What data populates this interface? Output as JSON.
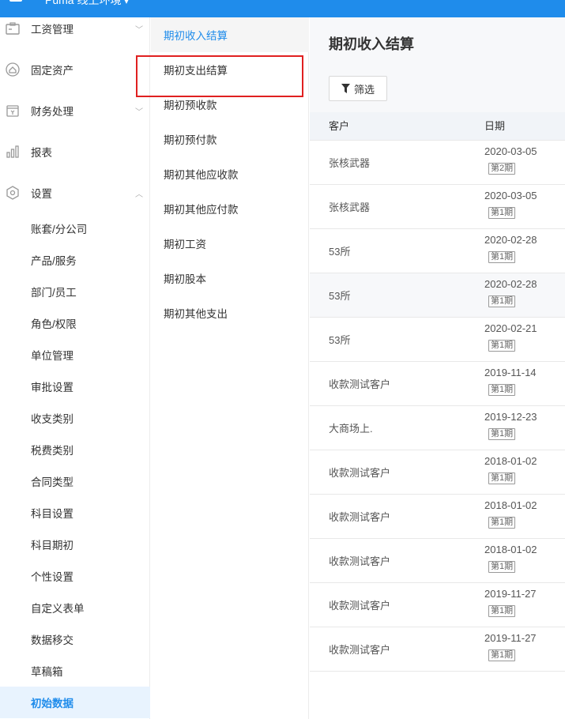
{
  "header": {
    "env_label": "Puma 线上环境",
    "chevron": "chevron-down-icon"
  },
  "sidebar": {
    "groups": [
      {
        "label": "工资管理",
        "icon": "payroll-icon",
        "chevron": "chevron-down-icon"
      },
      {
        "label": "固定资产",
        "icon": "asset-house-icon"
      },
      {
        "label": "财务处理",
        "icon": "finance-icon",
        "chevron": "chevron-down-icon"
      },
      {
        "label": "报表",
        "icon": "bar-chart-icon"
      },
      {
        "label": "设置",
        "icon": "settings-icon",
        "chevron": "chevron-up-icon"
      }
    ],
    "settings_items": [
      {
        "label": "账套/分公司"
      },
      {
        "label": "产品/服务"
      },
      {
        "label": "部门/员工"
      },
      {
        "label": "角色/权限"
      },
      {
        "label": "单位管理"
      },
      {
        "label": "审批设置"
      },
      {
        "label": "收支类别"
      },
      {
        "label": "税费类别"
      },
      {
        "label": "合同类型"
      },
      {
        "label": "科目设置"
      },
      {
        "label": "科目期初"
      },
      {
        "label": "个性设置"
      },
      {
        "label": "自定义表单"
      },
      {
        "label": "数据移交"
      },
      {
        "label": "草稿箱"
      },
      {
        "label": "初始数据"
      }
    ],
    "active_index": 15
  },
  "submenu": {
    "items": [
      {
        "label": "期初收入结算"
      },
      {
        "label": "期初支出结算"
      },
      {
        "label": "期初预收款"
      },
      {
        "label": "期初预付款"
      },
      {
        "label": "期初其他应收款"
      },
      {
        "label": "期初其他应付款"
      },
      {
        "label": "期初工资"
      },
      {
        "label": "期初股本"
      },
      {
        "label": "期初其他支出"
      }
    ],
    "active_index": 0,
    "highlighted_index": 1
  },
  "main": {
    "title": "期初收入结算",
    "filter_label": "筛选",
    "columns": [
      "客户",
      "日期"
    ],
    "rows": [
      {
        "customer": "张核武器",
        "date": "2020-03-05",
        "period": "第2期"
      },
      {
        "customer": "张核武器",
        "date": "2020-03-05",
        "period": "第1期"
      },
      {
        "customer": "53所",
        "date": "2020-02-28",
        "period": "第1期"
      },
      {
        "customer": "53所",
        "date": "2020-02-28",
        "period": "第1期"
      },
      {
        "customer": "53所",
        "date": "2020-02-21",
        "period": "第1期"
      },
      {
        "customer": "收款测试客户",
        "date": "2019-11-14",
        "period": "第1期"
      },
      {
        "customer": "大商场上.",
        "date": "2019-12-23",
        "period": "第1期"
      },
      {
        "customer": "收款测试客户",
        "date": "2018-01-02",
        "period": "第1期"
      },
      {
        "customer": "收款测试客户",
        "date": "2018-01-02",
        "period": "第1期"
      },
      {
        "customer": "收款测试客户",
        "date": "2018-01-02",
        "period": "第1期"
      },
      {
        "customer": "收款测试客户",
        "date": "2019-11-27",
        "period": "第1期"
      },
      {
        "customer": "收款测试客户",
        "date": "2019-11-27",
        "period": "第1期"
      }
    ]
  },
  "colors": {
    "brand": "#1f8ceb",
    "highlight": "#e02020",
    "active_bg": "#e8f3fe"
  }
}
